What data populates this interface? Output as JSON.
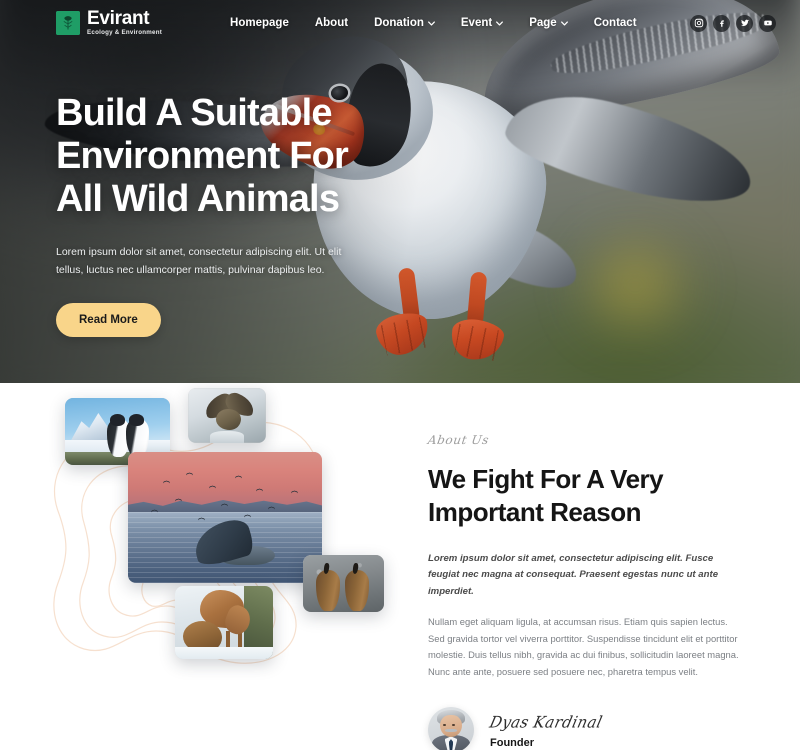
{
  "header": {
    "logo": {
      "name": "Evirant",
      "tagline": "Ecology & Environment",
      "mark_icon": "tree-icon",
      "mark_color": "#1f9d66"
    },
    "nav": [
      {
        "label": "Homepage",
        "dropdown": false
      },
      {
        "label": "About",
        "dropdown": false
      },
      {
        "label": "Donation",
        "dropdown": true
      },
      {
        "label": "Event",
        "dropdown": true
      },
      {
        "label": "Page",
        "dropdown": true
      },
      {
        "label": "Contact",
        "dropdown": false
      }
    ],
    "socials": [
      {
        "name": "instagram-icon",
        "label": "Instagram"
      },
      {
        "name": "facebook-icon",
        "label": "Facebook"
      },
      {
        "name": "twitter-icon",
        "label": "Twitter"
      },
      {
        "name": "youtube-icon",
        "label": "YouTube"
      }
    ]
  },
  "hero": {
    "title_line1": "Build A Suitable",
    "title_line2": "Environment For",
    "title_line3": "All Wild Animals",
    "subtitle": "Lorem ipsum dolor sit amet, consectetur adipiscing elit. Ut elit tellus, luctus nec ullamcorper mattis, pulvinar dapibus leo.",
    "cta_label": "Read More",
    "cta_color": "#f9d58a",
    "background_image": "atlantic-puffin-in-flight"
  },
  "about": {
    "eyebrow": "About Us",
    "heading_line1": "We Fight For A Very",
    "heading_line2": "Important Reason",
    "lead": "Lorem ipsum dolor sit amet, consectetur adipiscing elit. Fusce feugiat nec magna at consequat. Praesent egestas nunc ut ante imperdiet.",
    "body": "Nullam eget aliquam ligula, at accumsan risus. Etiam quis sapien lectus. Sed gravida tortor vel viverra porttitor. Suspendisse tincidunt elit et porttitor molestie. Duis tellus nibh, gravida ac dui finibus, sollicitudin laoreet magna. Nunc ante ante, posuere sed posuere nec, pharetra tempus velit.",
    "founder": {
      "signature": "Dyas Kardinal",
      "role": "Founder",
      "avatar": "founder-portrait"
    },
    "gallery": [
      {
        "name": "penguins-on-snowy-shore"
      },
      {
        "name": "bird-of-prey-landing"
      },
      {
        "name": "whale-fluke-at-sunset"
      },
      {
        "name": "two-penguin-chicks"
      },
      {
        "name": "deer-in-snow"
      }
    ]
  }
}
